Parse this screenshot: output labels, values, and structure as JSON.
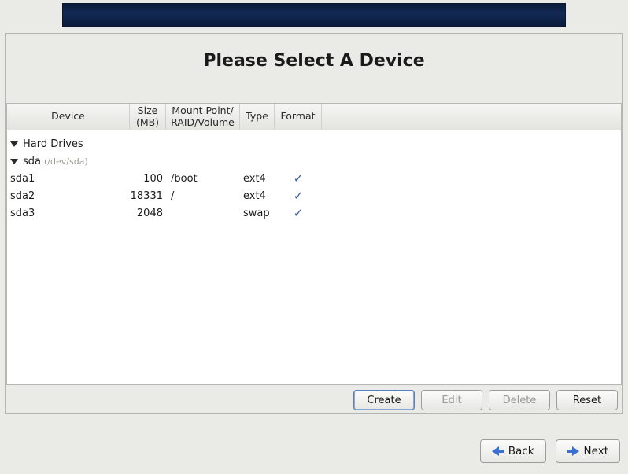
{
  "title": "Please Select A Device",
  "columns": {
    "device": "Device",
    "size": "Size (MB)",
    "mount": "Mount Point/ RAID/Volume",
    "type": "Type",
    "format": "Format"
  },
  "tree": {
    "group_label": "Hard Drives",
    "disk": {
      "name": "sda",
      "path": "(/dev/sda)"
    },
    "partitions": [
      {
        "name": "sda1",
        "size": "100",
        "mount": "/boot",
        "type": "ext4",
        "format": true
      },
      {
        "name": "sda2",
        "size": "18331",
        "mount": "/",
        "type": "ext4",
        "format": true
      },
      {
        "name": "sda3",
        "size": "2048",
        "mount": "",
        "type": "swap",
        "format": true
      }
    ]
  },
  "buttons": {
    "create": "Create",
    "edit": "Edit",
    "delete": "Delete",
    "reset": "Reset",
    "back": "Back",
    "next": "Next"
  }
}
